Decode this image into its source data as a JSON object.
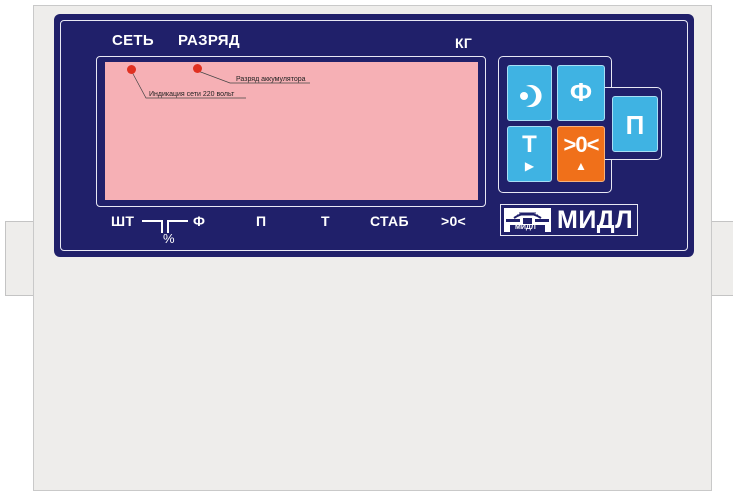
{
  "indicators": {
    "network": "СЕТЬ",
    "discharge": "РАЗРЯД",
    "unit": "КГ"
  },
  "lcd": {
    "network_note": "Индикация сети 220 вольт",
    "battery_note": "Разряд аккумулятора"
  },
  "bottom_labels": {
    "pieces": "ШТ",
    "percent": "%",
    "fixing": "Ф",
    "p": "П",
    "t": "Т",
    "stab": "СТАБ",
    "zero": ">0<"
  },
  "keys": {
    "fix": "Ф",
    "tare": "Т",
    "zero": ">0<",
    "p": "П"
  },
  "logo": {
    "brand": "МИДЛ",
    "emblem_text": "МИДЛ"
  },
  "colors": {
    "panel": "#20206a",
    "display": "#f6b0b5",
    "key_blue": "#3fb3e3",
    "key_orange": "#f0701a",
    "led": "#e03020"
  }
}
